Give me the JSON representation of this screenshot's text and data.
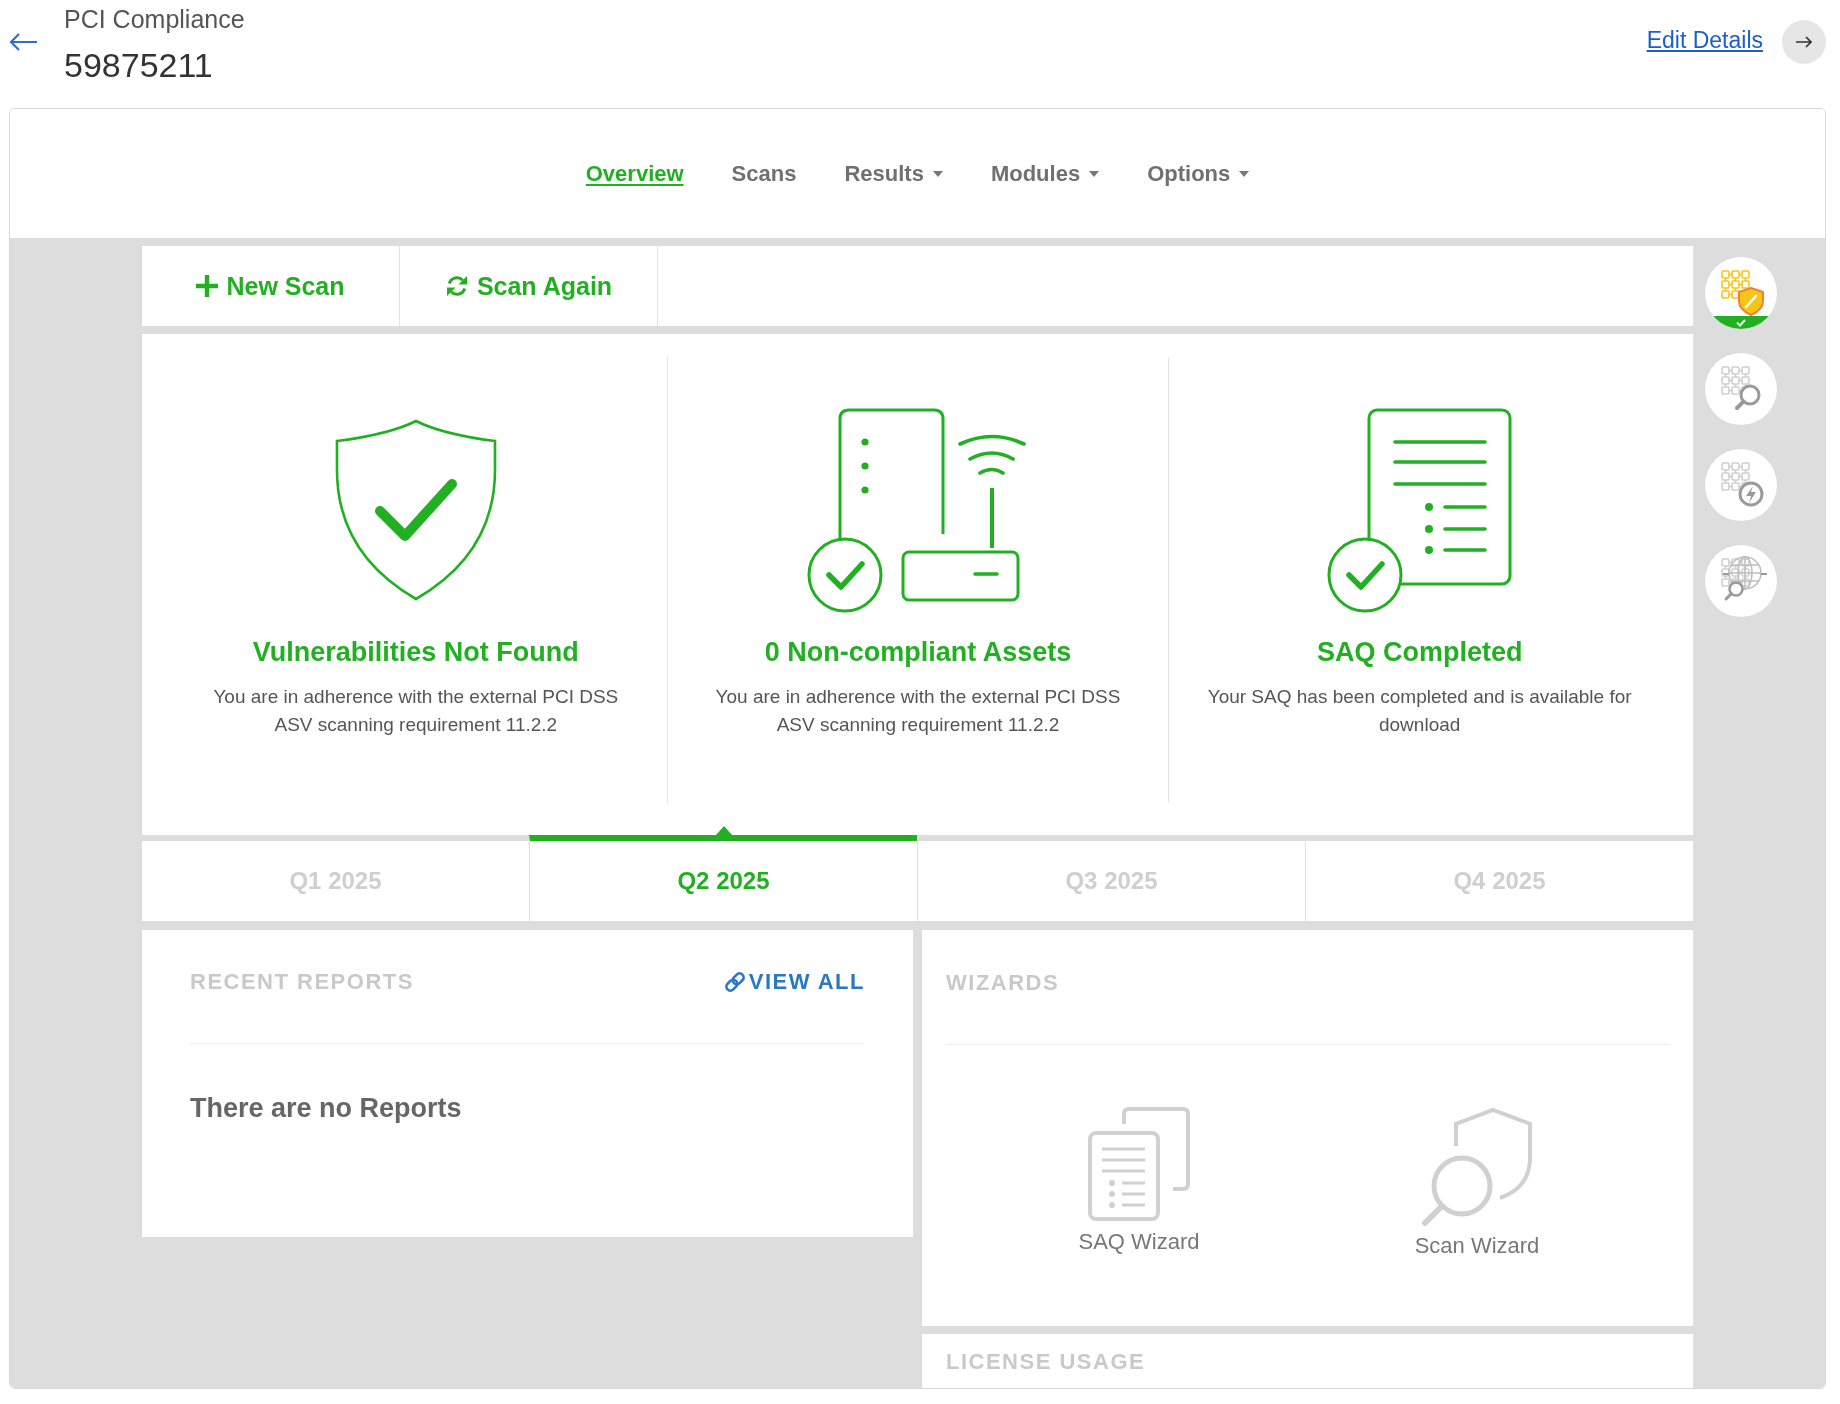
{
  "header": {
    "subtitle": "PCI Compliance",
    "title": "59875211",
    "edit_link": "Edit Details"
  },
  "nav": [
    {
      "label": "Overview",
      "selected": true,
      "dropdown": false
    },
    {
      "label": "Scans",
      "selected": false,
      "dropdown": false
    },
    {
      "label": "Results",
      "selected": false,
      "dropdown": true
    },
    {
      "label": "Modules",
      "selected": false,
      "dropdown": true
    },
    {
      "label": "Options",
      "selected": false,
      "dropdown": true
    }
  ],
  "toolbar": [
    {
      "label": "New Scan",
      "kind": "create"
    },
    {
      "label": "Scan Again",
      "kind": "rerun"
    }
  ],
  "status_cards": [
    {
      "kind": "vulnerabilities",
      "title": "Vulnerabilities Not Found",
      "description": "You are in adherence with the external PCI DSS ASV scanning requirement 11.2.2"
    },
    {
      "kind": "assets",
      "title": "0 Non-compliant Assets",
      "description": "You are in adherence with the external PCI DSS ASV scanning requirement 11.2.2"
    },
    {
      "kind": "saq",
      "title": "SAQ Completed",
      "description": "Your SAQ has been completed and is available for download"
    }
  ],
  "quarters": [
    {
      "label": "Q1 2025",
      "selected": false
    },
    {
      "label": "Q2 2025",
      "selected": true
    },
    {
      "label": "Q3 2025",
      "selected": false
    },
    {
      "label": "Q4 2025",
      "selected": false
    }
  ],
  "recent_reports": {
    "title": "RECENT REPORTS",
    "view_all": "VIEW ALL",
    "empty_message": "There are no Reports"
  },
  "wizards": {
    "title": "WIZARDS",
    "items": [
      {
        "label": "SAQ Wizard",
        "kind": "saq"
      },
      {
        "label": "Scan Wizard",
        "kind": "scan"
      }
    ]
  },
  "license_usage": {
    "title": "LICENSE USAGE"
  },
  "side_steps": [
    {
      "kind": "protection",
      "selected": true
    },
    {
      "kind": "search",
      "selected": false
    },
    {
      "kind": "power",
      "selected": false
    },
    {
      "kind": "globe",
      "selected": false
    }
  ]
}
